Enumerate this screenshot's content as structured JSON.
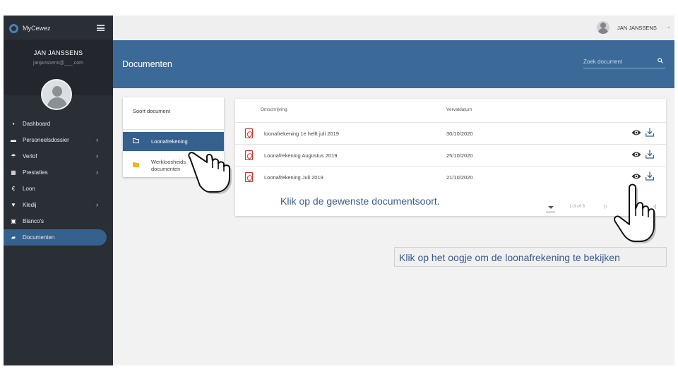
{
  "sidebar": {
    "brand": "MyCewez",
    "profile_name": "JAN JANSSENS",
    "profile_email": "janjanssens@___.com",
    "items": [
      {
        "label": "Dashboard",
        "icon": "dashboard-icon",
        "chevron": false
      },
      {
        "label": "Personeelsdossier",
        "icon": "id-card-icon",
        "chevron": true
      },
      {
        "label": "Verlof",
        "icon": "beach-umbrella-icon",
        "chevron": true
      },
      {
        "label": "Prestaties",
        "icon": "calendar-icon",
        "chevron": true
      },
      {
        "label": "Loon",
        "icon": "euro-icon",
        "chevron": false
      },
      {
        "label": "Kledij",
        "icon": "shirt-icon",
        "chevron": true
      },
      {
        "label": "Blanco's",
        "icon": "calendar-blank-icon",
        "chevron": false
      },
      {
        "label": "Documenten",
        "icon": "folder-open-icon",
        "chevron": false,
        "active": true
      }
    ]
  },
  "topbar": {
    "user": "JAN JANSSENS"
  },
  "header": {
    "title": "Documenten",
    "search_placeholder": "Zoek document"
  },
  "categories": {
    "title": "Soort document",
    "items": [
      {
        "label": "Loonafrekening",
        "selected": true
      },
      {
        "label": "Werkloosheids documenten",
        "selected": false
      }
    ]
  },
  "documents": {
    "columns": {
      "description": "Omschrijving",
      "expiry": "Vervaldatum"
    },
    "rows": [
      {
        "description": "loonafrekening 1e helft juli 2019",
        "expiry": "30/10/2020"
      },
      {
        "description": "Loonafrekening Augustus 2019",
        "expiry": "25/10/2020"
      },
      {
        "description": "Loonafrekening Juli 2019",
        "expiry": "21/10/2020"
      }
    ],
    "range": "1-3 of 3"
  },
  "callouts": {
    "step1": "Klik op de gewenste documentsoort.",
    "step2": "Klik op het oogje om de loonafrekening te bekijken"
  },
  "colors": {
    "sidebar_bg": "#2a2f36",
    "header_bg": "#3b6a98",
    "active_bg": "#35618e",
    "pdf_red": "#d9302c",
    "callout_text": "#3b5a8c"
  }
}
